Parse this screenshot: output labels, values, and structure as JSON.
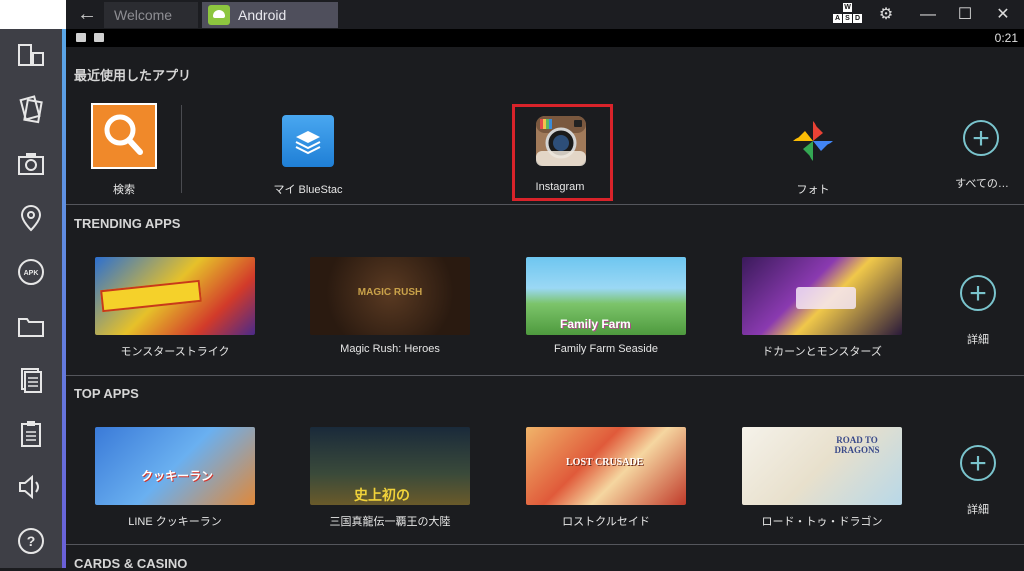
{
  "titlebar": {
    "tabs": [
      {
        "label": "Welcome"
      },
      {
        "label": "Android"
      }
    ],
    "wasd_keys": [
      "W",
      "A",
      "S",
      "D"
    ]
  },
  "statusbar": {
    "time": "0:21"
  },
  "recent": {
    "title": "最近使用したアプリ",
    "apps": [
      {
        "label": "検索",
        "icon": "search-icon"
      },
      {
        "label": "マイ BlueStac",
        "icon": "bluestacks-stack-icon"
      },
      {
        "label": "Instagram",
        "icon": "instagram-camera-icon"
      },
      {
        "label": "フォト",
        "icon": "photos-pinwheel-icon"
      },
      {
        "label": "すべての…",
        "icon": "plus-circle-icon"
      }
    ]
  },
  "trending": {
    "title": "TRENDING APPS",
    "apps": [
      {
        "label": "モンスターストライク"
      },
      {
        "label": "Magic Rush: Heroes",
        "tile_text": "MAGIC RUSH"
      },
      {
        "label": "Family Farm Seaside",
        "tile_text": "Family Farm"
      },
      {
        "label": "ドカーンとモンスターズ"
      }
    ],
    "more_label": "詳細"
  },
  "top": {
    "title": "TOP APPS",
    "apps": [
      {
        "label": "LINE クッキーラン",
        "tile_text": "クッキーラン"
      },
      {
        "label": "三国真龍伝一覇王の大陸",
        "tile_text": "史上初の"
      },
      {
        "label": "ロストクルセイド",
        "tile_text": "LOST CRUSADE"
      },
      {
        "label": "ロード・トゥ・ドラゴン",
        "tile_text": "ROAD TO DRAGONS"
      }
    ],
    "more_label": "詳細"
  },
  "cards": {
    "title": "CARDS & CASINO"
  },
  "colors": {
    "highlight": "#d9232a",
    "accent": "#7ac4cd",
    "search_bg": "#f0892a"
  }
}
